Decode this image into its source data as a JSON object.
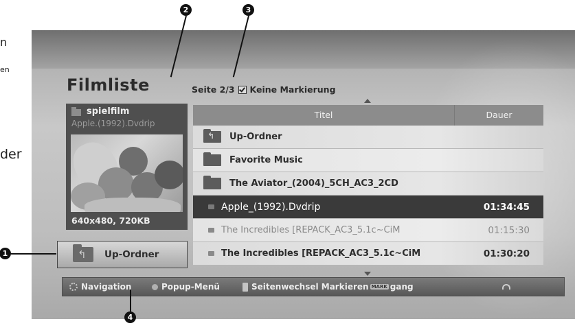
{
  "margin_text": {
    "frag_a": "n",
    "frag_b": "en",
    "frag_c": "der"
  },
  "screen": {
    "title": "Filmliste",
    "page_indicator": "Seite 2/3",
    "mark_status": "Keine Markierung",
    "preview": {
      "folder_name": "spielfilm",
      "file_name": "Apple.(1992).Dvdrip",
      "resolution_size": "640x480, 720KB"
    },
    "up_folder_button": "Up-Ordner",
    "list": {
      "col_title": "Titel",
      "col_duration": "Dauer",
      "rows": [
        {
          "name": "Up-Ordner",
          "duration": "",
          "kind": "folder-up"
        },
        {
          "name": "Favorite Music",
          "duration": "",
          "kind": "folder"
        },
        {
          "name": "The Aviator_(2004)_5CH_AC3_2CD",
          "duration": "",
          "kind": "folder"
        },
        {
          "name": "Apple_(1992).Dvdrip",
          "duration": "01:34:45",
          "kind": "video",
          "state": "selected"
        },
        {
          "name": "The Incredibles [REPACK_AC3_5.1c~CiM",
          "duration": "01:15:30",
          "kind": "video",
          "state": "disabled"
        },
        {
          "name": "The Incredibles [REPACK_AC3_5.1c~CiM",
          "duration": "01:30:20",
          "kind": "video"
        }
      ]
    },
    "bottom_bar": {
      "navigation": "Navigation",
      "popup_menu": "Popup-Menü",
      "page_change_mark": "Seitenwechsel Markieren",
      "mark_badge": "MARK",
      "exit": "gang"
    }
  },
  "callouts": [
    "1",
    "2",
    "3",
    "4"
  ]
}
